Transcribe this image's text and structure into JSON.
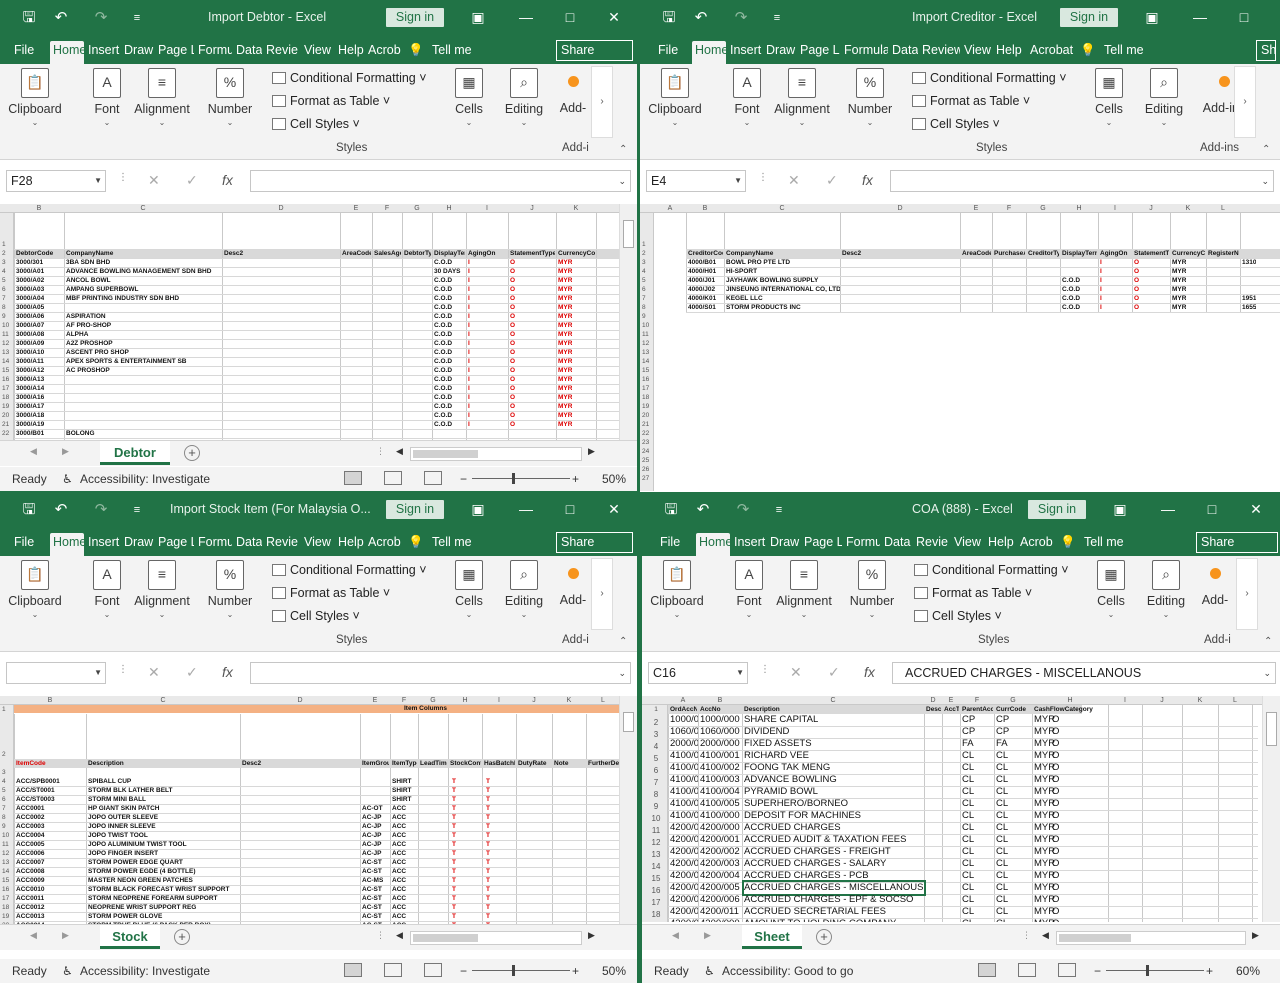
{
  "common": {
    "tabs_full": [
      "File",
      "Home",
      "Insert",
      "Draw",
      "Page L",
      "Formu",
      "Data",
      "Revie",
      "View",
      "Help",
      "Acrob"
    ],
    "tell_me": "Tell me",
    "share": "Share",
    "sign_in": "Sign in",
    "ribbon": {
      "clipboard": "Clipboard",
      "font": "Font",
      "alignment": "Alignment",
      "number": "Number",
      "conditional_formatting": "Conditional Formatting",
      "format_as_table": "Format as Table",
      "cell_styles": "Cell Styles",
      "styles_group": "Styles",
      "cells": "Cells",
      "editing": "Editing",
      "addins": "Add-ins",
      "addins_short": "Add-",
      "addins_group_short": "Add-i",
      "number_glyph": "%",
      "font_glyph": "A"
    },
    "fx": "fx",
    "ready": "Ready",
    "accessibility_investigate": "Accessibility: Investigate",
    "accessibility_good": "Accessibility: Good to go",
    "zoom_50": "50%",
    "zoom_60": "60%"
  },
  "win_tl": {
    "title": "Import Debtor  -  Excel",
    "name_box": "F28",
    "formula": "",
    "sheet": "Debtor",
    "columns": [
      "B",
      "C",
      "D",
      "E",
      "F",
      "G",
      "H",
      "I",
      "J",
      "K"
    ],
    "rows": [
      "1",
      "2",
      "3",
      "4",
      "5",
      "6",
      "7",
      "8",
      "9",
      "10",
      "11",
      "12",
      "13",
      "14",
      "15",
      "16",
      "17",
      "18",
      "19",
      "20",
      "21",
      "22"
    ],
    "header_row": [
      "DebtorCode",
      "CompanyName",
      "Desc2",
      "AreaCode",
      "SalesAgent",
      "DebtorType",
      "DisplayTerm",
      "AgingOn",
      "StatementType",
      "CurrencyCode"
    ],
    "codes": [
      "3000/301",
      "3000/A01",
      "3000/A02",
      "3000/A03",
      "3000/A04",
      "3000/A05",
      "3000/A06",
      "3000/A07",
      "3000/A08",
      "3000/A09",
      "3000/A10",
      "3000/A11",
      "3000/A12",
      "3000/A13",
      "3000/A14",
      "3000/A16",
      "3000/A17",
      "3000/A18",
      "3000/A19"
    ],
    "names": [
      "3BA SDN BHD",
      "ADVANCE BOWLING MANAGEMENT SDN BHD",
      "ANCOL BOWL",
      "AMPANG SUPERBOWL",
      "MBF PRINTING INDUSTRY SDN BHD",
      "",
      "ASPIRATION",
      "AF PRO-SHOP",
      "ALPHA",
      "A2Z PROSHOP",
      "ASCENT PRO SHOP",
      "APEX SPORTS & ENTERTAINMENT SB",
      "AC PROSHOP",
      "",
      "",
      "",
      "",
      "",
      ""
    ],
    "terms": [
      "C.O.D",
      "30 DAYS",
      "C.O.D",
      "C.O.D",
      "C.O.D",
      "C.O.D",
      "C.O.D",
      "C.O.D",
      "C.O.D",
      "C.O.D",
      "C.O.D",
      "C.O.D",
      "C.O.D",
      "C.O.D",
      "C.O.D",
      "C.O.D",
      "C.O.D",
      "C.O.D",
      "C.O.D"
    ],
    "currency": "MYR",
    "last_row_code": "3000/B01",
    "last_row_name": "BOLONG"
  },
  "win_tr": {
    "title": "Import Creditor  -  Excel",
    "name_box": "E4",
    "formula": "",
    "tabs": [
      "File",
      "Home",
      "Insert",
      "Draw",
      "Page La",
      "Formula",
      "Data",
      "Review",
      "View",
      "Help",
      "Acrobat"
    ],
    "columns": [
      "A",
      "B",
      "C",
      "D",
      "E",
      "F",
      "G",
      "H",
      "I",
      "J",
      "K",
      "L"
    ],
    "rows": [
      "1",
      "2",
      "3",
      "4",
      "5",
      "6",
      "7",
      "8",
      "9",
      "10",
      "11",
      "12",
      "13",
      "14",
      "15",
      "16",
      "17",
      "18",
      "19",
      "20",
      "21",
      "22",
      "23",
      "24",
      "25",
      "26",
      "27"
    ],
    "header_row": [
      "CreditorCode",
      "CompanyName",
      "Desc2",
      "AreaCode",
      "PurchaseAgent",
      "CreditorType",
      "DisplayTerm",
      "AgingOn",
      "StatementType",
      "CurrencyCode",
      "RegisterNo"
    ],
    "codes": [
      "4000/B01",
      "4000/H01",
      "4000/J01",
      "4000/J02",
      "4000/K01",
      "4000/S01"
    ],
    "names": [
      "BOWL PRO PTE LTD",
      "HI-SPORT",
      "JAYHAWK BOWLING SUPPLY",
      "JINSEUNG INTERNATIONAL CO, LTD",
      "KEGEL LLC",
      "STORM PRODUCTS INC"
    ],
    "terms": [
      "",
      "",
      "C.O.D",
      "C.O.D",
      "C.O.D",
      "C.O.D"
    ],
    "reg": [
      "1310",
      "",
      "",
      "",
      "1951",
      "1655"
    ],
    "currency": "MYR"
  },
  "win_bl": {
    "title": "Import Stock Item (For Malaysia O...",
    "name_box": "",
    "formula": "",
    "sheet": "Stock",
    "columns": [
      "B",
      "C",
      "D",
      "E",
      "F",
      "G",
      "H",
      "I",
      "J",
      "K",
      "L"
    ],
    "rows": [
      "1",
      "2",
      "3",
      "4",
      "5",
      "6",
      "7",
      "8",
      "9",
      "10",
      "11",
      "12",
      "13",
      "14",
      "15",
      "16",
      "17",
      "18",
      "19",
      "20",
      "21"
    ],
    "band_title": "Item Columns",
    "header_row": [
      "ItemCode",
      "Description",
      "Desc2",
      "ItemGroup",
      "ItemType",
      "LeadTime",
      "StockControl",
      "HasBatchNo",
      "DutyRate",
      "Note",
      "FurtherDescription"
    ],
    "codes": [
      "ACC/SPB0001",
      "ACC/ST0001",
      "ACC/ST0003",
      "ACC0001",
      "ACC0002",
      "ACC0003",
      "ACC0004",
      "ACC0005",
      "ACC0006",
      "ACC0007",
      "ACC0008",
      "ACC0009",
      "ACC0010",
      "ACC0011",
      "ACC0012",
      "ACC0013",
      "ACC0014",
      "ACC0015"
    ],
    "descs": [
      "SPIBALL CUP",
      "STORM BLK LATHER BELT",
      "STORM MINI BALL",
      "HP GIANT SKIN PATCH",
      "JOPO OUTER SLEEVE",
      "JOPO INNER SLEEVE",
      "JOPO TWIST TOOL",
      "JOPO ALUMINIUM TWIST TOOL",
      "JOPO FINGER INSERT",
      "STORM POWER EDGE QUART",
      "STORM POWER EGDE (4 BOTTLE)",
      "MASTER NEON GREEN PATCHES",
      "STORM BLACK FORECAST WRIST SUPPORT",
      "STORM NEOPRENE FOREARM SUPPORT",
      "NEOPRENE WRIST SUPPORT REG",
      "STORM POWER GLOVE",
      "STORM TRUE BLUE (6 PACK PER BOX)",
      "STORM WRIST LINER"
    ],
    "groups": [
      "",
      "",
      "",
      "AC-OT",
      "AC-JP",
      "AC-JP",
      "AC-JP",
      "AC-JP",
      "AC-JP",
      "AC-ST",
      "AC-ST",
      "AC-MS",
      "AC-ST",
      "AC-ST",
      "AC-ST",
      "AC-ST",
      "AC-ST",
      "AC-ST"
    ],
    "types": [
      "SHIRT",
      "SHIRT",
      "SHIRT",
      "ACC",
      "ACC",
      "ACC",
      "ACC",
      "ACC",
      "ACC",
      "ACC",
      "ACC",
      "ACC",
      "ACC",
      "ACC",
      "ACC",
      "ACC",
      "ACC",
      "ACC"
    ],
    "flag": "T"
  },
  "win_br": {
    "title": "COA (888)  -  Excel",
    "name_box": "C16",
    "formula": "ACCRUED CHARGES - MISCELLANOUS",
    "sheet": "Sheet",
    "tabs": [
      "File",
      "Home",
      "Insert",
      "Draw",
      "Page L",
      "Formu",
      "Data",
      "Revie",
      "View",
      "Help",
      "Acrob"
    ],
    "columns": [
      "A",
      "B",
      "C",
      "D",
      "E",
      "F",
      "G",
      "H",
      "I",
      "J",
      "K",
      "L"
    ],
    "header_row": [
      "OrdAccNo",
      "AccNo",
      "Description",
      "Desc2",
      "AccType",
      "ParentAccNo",
      "CurrCode",
      "CashFlowCategory"
    ],
    "rows": [
      {
        "n": "2",
        "a": "1000/000",
        "b": "1000/000",
        "c": "SHARE CAPITAL",
        "e": "CP",
        "f": "CP",
        "g": "MYR",
        "h": "O"
      },
      {
        "n": "3",
        "a": "1060/000",
        "b": "1060/000",
        "c": "DIVIDEND",
        "e": "CP",
        "f": "CP",
        "g": "MYR",
        "h": "O"
      },
      {
        "n": "4",
        "a": "2000/000",
        "b": "2000/000",
        "c": "FIXED ASSETS",
        "e": "FA",
        "f": "FA",
        "g": "MYR",
        "h": "O"
      },
      {
        "n": "5",
        "a": "4100/001",
        "b": "4100/001",
        "c": "RICHARD VEE",
        "e": "CL",
        "f": "CL",
        "g": "MYR",
        "h": "O"
      },
      {
        "n": "6",
        "a": "4100/002",
        "b": "4100/002",
        "c": "FOONG TAK MENG",
        "e": "CL",
        "f": "CL",
        "g": "MYR",
        "h": "O"
      },
      {
        "n": "7",
        "a": "4100/003",
        "b": "4100/003",
        "c": "ADVANCE BOWLING",
        "e": "CL",
        "f": "CL",
        "g": "MYR",
        "h": "O"
      },
      {
        "n": "8",
        "a": "4100/004",
        "b": "4100/004",
        "c": "PYRAMID BOWL",
        "e": "CL",
        "f": "CL",
        "g": "MYR",
        "h": "O"
      },
      {
        "n": "9",
        "a": "4100/005",
        "b": "4100/005",
        "c": "SUPERHERO/BORNEO",
        "e": "CL",
        "f": "CL",
        "g": "MYR",
        "h": "O"
      },
      {
        "n": "10",
        "a": "4100/000",
        "b": "4100/000",
        "c": "DEPOSIT FOR MACHINES",
        "e": "CL",
        "f": "CL",
        "g": "MYR",
        "h": "O"
      },
      {
        "n": "11",
        "a": "4200/000",
        "b": "4200/000",
        "c": "ACCRUED CHARGES",
        "e": "CL",
        "f": "CL",
        "g": "MYR",
        "h": "O"
      },
      {
        "n": "12",
        "a": "4200/001",
        "b": "4200/001",
        "c": "ACCRUED AUDIT & TAXATION FEES",
        "e": "CL",
        "f": "CL",
        "g": "MYR",
        "h": "O"
      },
      {
        "n": "13",
        "a": "4200/002",
        "b": "4200/002",
        "c": "ACCRUED CHARGES - FREIGHT",
        "e": "CL",
        "f": "CL",
        "g": "MYR",
        "h": "O"
      },
      {
        "n": "14",
        "a": "4200/003",
        "b": "4200/003",
        "c": "ACCRUED CHARGES - SALARY",
        "e": "CL",
        "f": "CL",
        "g": "MYR",
        "h": "O"
      },
      {
        "n": "15",
        "a": "4200/004",
        "b": "4200/004",
        "c": "ACCRUED CHARGES - PCB",
        "e": "CL",
        "f": "CL",
        "g": "MYR",
        "h": "O"
      },
      {
        "n": "16",
        "a": "4200/005",
        "b": "4200/005",
        "c": "ACCRUED CHARGES - MISCELLANOUS",
        "e": "CL",
        "f": "CL",
        "g": "MYR",
        "h": "O"
      },
      {
        "n": "17",
        "a": "4200/006",
        "b": "4200/006",
        "c": "ACCRUED CHARGES - EPF & SOCSO",
        "e": "CL",
        "f": "CL",
        "g": "MYR",
        "h": "O"
      },
      {
        "n": "18",
        "a": "4200/011",
        "b": "4200/011",
        "c": "ACCRUED SECRETARIAL FEES",
        "e": "CL",
        "f": "CL",
        "g": "MYR",
        "h": "O"
      },
      {
        "n": "19",
        "a": "4300/000",
        "b": "4300/000",
        "c": "AMOUNT TO HOLDING COMPANY",
        "e": "CL",
        "f": "CL",
        "g": "MYR",
        "h": "O"
      }
    ]
  }
}
